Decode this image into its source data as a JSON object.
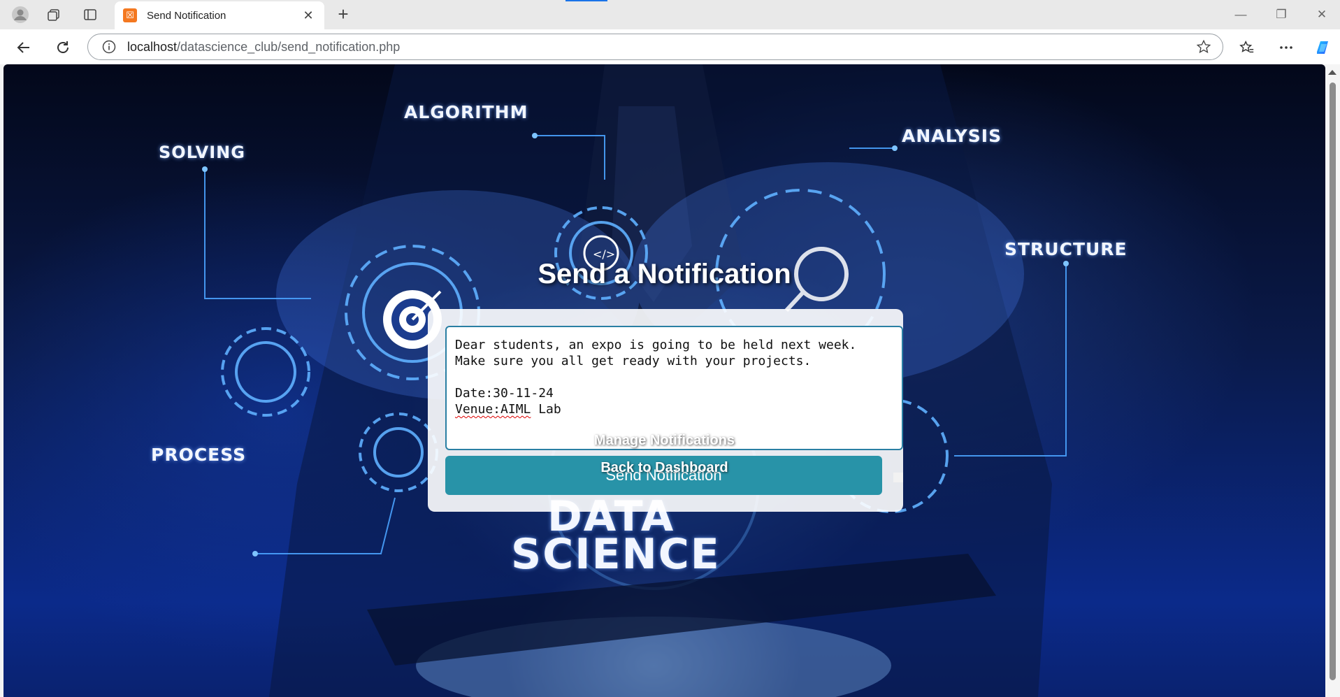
{
  "browser": {
    "tab": {
      "title": "Send Notification",
      "favicon": "xampp-icon",
      "close": "✕"
    },
    "new_tab": "+",
    "window_controls": {
      "minimize": "—",
      "restore": "❐",
      "close": "✕"
    },
    "address": {
      "host": "localhost",
      "path": "/datascience_club/send_notification.php"
    },
    "icons": [
      "profile-icon",
      "workspaces-icon",
      "tab-actions-icon",
      "back-icon",
      "refresh-icon",
      "site-info-icon",
      "favorite-star-icon",
      "favorites-icon",
      "more-icon",
      "copilot-icon"
    ]
  },
  "background": {
    "words": {
      "algorithm": "ALGORITHM",
      "solving": "SOLVING",
      "analysis": "ANALYSIS",
      "structure": "STRUCTURE",
      "process": "PROCESS",
      "data": "DATA",
      "science": "SCIENCE"
    }
  },
  "page": {
    "title": "Send a Notification",
    "message_lines": [
      "Dear students, an expo is going to be held next week.",
      "Make sure you all get ready with your projects.",
      "",
      "Date:30-11-24"
    ],
    "venue_label": "Venue:",
    "venue_prefix_marked": "Venue:AIML",
    "venue_rest": " Lab",
    "send_button": "Send Notification",
    "manage_link": "Manage Notifications",
    "dashboard_link": "Back to Dashboard"
  },
  "colors": {
    "send_button": "#2893a8",
    "textarea_border": "#2a7fa3",
    "address_accent": "#1a73e8"
  }
}
